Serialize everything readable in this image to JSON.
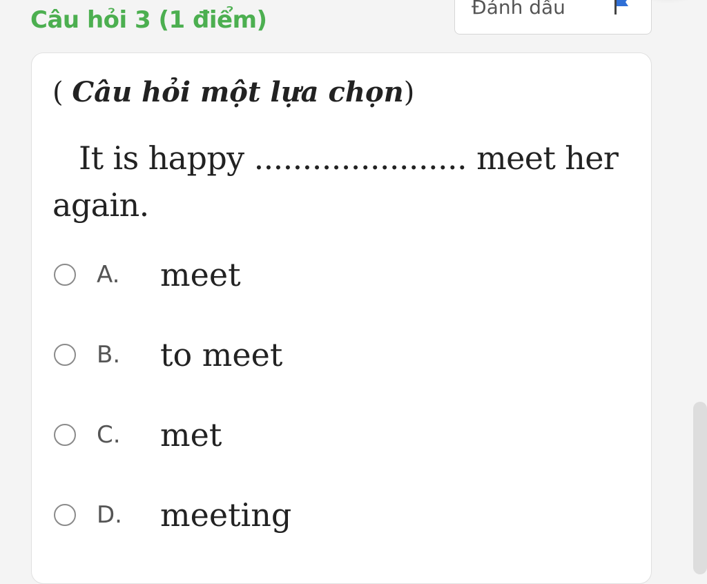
{
  "header": {
    "question_title": "Câu hỏi 3 (1 điểm)",
    "flag_label": "Đánh dấu",
    "flag_icon": "flag-icon"
  },
  "question": {
    "type_open": "( ",
    "type_label": "Câu hỏi một lựa chọn",
    "type_close": ")",
    "text": "It is happy ...................... meet her again."
  },
  "options": [
    {
      "letter": "A.",
      "text": "meet"
    },
    {
      "letter": "B.",
      "text": "to meet"
    },
    {
      "letter": "C.",
      "text": "met"
    },
    {
      "letter": "D.",
      "text": "meeting"
    }
  ],
  "colors": {
    "accent_green": "#4caf50",
    "flag_blue": "#2f6fd6",
    "background": "#f4f4f4",
    "card": "#ffffff"
  }
}
